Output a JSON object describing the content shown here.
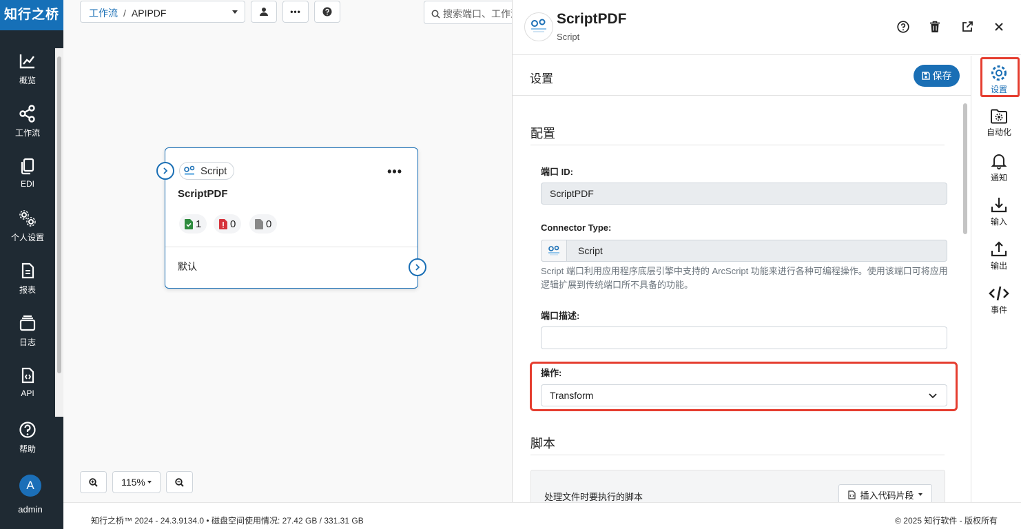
{
  "app": {
    "logo": "知行之桥"
  },
  "nav": [
    {
      "label": "概览",
      "icon": "chart-line-icon"
    },
    {
      "label": "工作流",
      "icon": "workflow-icon"
    },
    {
      "label": "EDI",
      "icon": "copy-icon"
    },
    {
      "label": "个人设置",
      "icon": "gears-icon"
    },
    {
      "label": "报表",
      "icon": "report-icon"
    },
    {
      "label": "日志",
      "icon": "log-icon"
    },
    {
      "label": "API",
      "icon": "api-icon"
    },
    {
      "label": "帮助",
      "icon": "help-icon"
    }
  ],
  "user": {
    "initial": "A",
    "name": "admin"
  },
  "breadcrumb": {
    "parent": "工作流",
    "sep": "/",
    "current": "APIPDF"
  },
  "search": {
    "placeholder": "搜索端口、工作流"
  },
  "node": {
    "type_label": "Script",
    "title": "ScriptPDF",
    "more": "•••",
    "success_count": "1",
    "error_count": "0",
    "pending_count": "0",
    "output_label": "默认"
  },
  "zoom": {
    "level": "115%"
  },
  "footer": {
    "left": "知行之桥™ 2024 - 24.3.9134.0  •  磁盘空间使用情况:  27.42 GB / 331.31 GB",
    "right": "© 2025 知行软件 - 版权所有"
  },
  "panel": {
    "title": "ScriptPDF",
    "subtitle": "Script",
    "section_title": "设置",
    "save_label": "保存",
    "config_title": "配置",
    "port_id_label": "端口 ID:",
    "port_id_value": "ScriptPDF",
    "connector_type_label": "Connector Type:",
    "connector_type_value": "Script",
    "connector_desc": "Script 端口利用应用程序底层引擎中支持的 ArcScript 功能来进行各种可编程操作。使用该端口可将应用逻辑扩展到传统端口所不具备的功能。",
    "port_desc_label": "端口描述:",
    "port_desc_value": "",
    "operation_label": "操作:",
    "operation_value": "Transform",
    "script_title": "脚本",
    "script_hint": "处理文件时要执行的脚本",
    "snippet_label": "插入代码片段"
  },
  "tabs": [
    {
      "label": "设置",
      "icon": "gear-icon"
    },
    {
      "label": "自动化",
      "icon": "folder-gear-icon"
    },
    {
      "label": "通知",
      "icon": "bell-icon"
    },
    {
      "label": "输入",
      "icon": "download-icon"
    },
    {
      "label": "输出",
      "icon": "upload-icon"
    },
    {
      "label": "事件",
      "icon": "code-icon"
    }
  ],
  "colors": {
    "primary": "#1a6fb5",
    "nav_bg": "#1f2a33",
    "highlight": "#e53d2f"
  }
}
